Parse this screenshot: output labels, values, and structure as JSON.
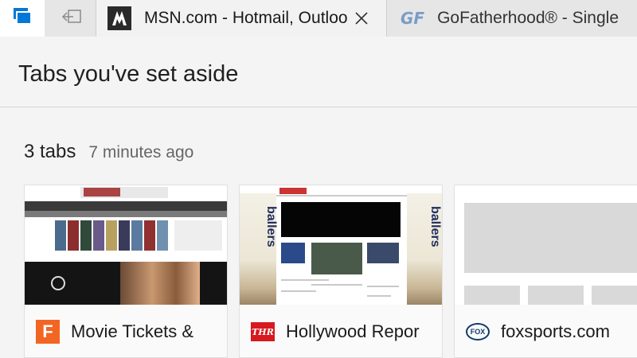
{
  "tabstrip": {
    "aside_icon": "tabs-aside-icon",
    "setaside_icon": "set-tabs-aside-icon",
    "active_tab": {
      "title": "MSN.com - Hotmail, Outlook, Skype, Bing",
      "favicon": "msn-favicon"
    },
    "inactive_tab": {
      "title": "GoFatherhood® - Single",
      "logo": "GF"
    }
  },
  "panel": {
    "title": "Tabs you've set aside",
    "group": {
      "count": "3 tabs",
      "time": "7 minutes ago"
    },
    "cards": [
      {
        "label": "Movie Tickets &",
        "favicon": "fandango-favicon",
        "favicon_text": "F"
      },
      {
        "label": "Hollywood Repor",
        "favicon": "thr-favicon",
        "favicon_text": "THR"
      },
      {
        "label": "foxsports.com",
        "favicon": "fox-favicon",
        "favicon_text": "FOX"
      }
    ],
    "thumb2_text": "ballers"
  },
  "colors": {
    "accent": "#0063b1",
    "tabstrip_bg": "#e6e6e6",
    "panel_bg": "#f4f4f4"
  }
}
